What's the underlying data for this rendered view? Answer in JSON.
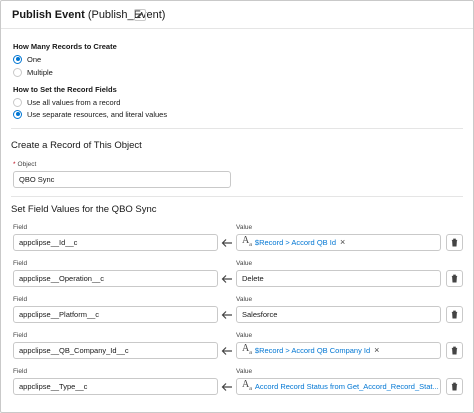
{
  "header": {
    "label": "Publish Event",
    "api_name": "(Publish_Event)"
  },
  "records_to_create": {
    "label": "How Many Records to Create",
    "options": [
      {
        "label": "One",
        "selected": true
      },
      {
        "label": "Multiple",
        "selected": false
      }
    ]
  },
  "set_fields": {
    "label": "How to Set the Record Fields",
    "options": [
      {
        "label": "Use all values from a record",
        "selected": false
      },
      {
        "label": "Use separate resources, and literal values",
        "selected": true
      }
    ]
  },
  "create_record": {
    "title": "Create a Record of This Object",
    "object_label": "Object",
    "object_value": "QBO Sync"
  },
  "field_values": {
    "title": "Set Field Values for the QBO Sync",
    "field_label": "Field",
    "value_label": "Value",
    "rows": [
      {
        "field": "appclipse__Id__c",
        "value": "$Record > Accord QB Id",
        "is_resource": true
      },
      {
        "field": "appclipse__Operation__c",
        "value": "Delete",
        "is_resource": false
      },
      {
        "field": "appclipse__Platform__c",
        "value": "Salesforce",
        "is_resource": false
      },
      {
        "field": "appclipse__QB_Company_Id__c",
        "value": "$Record > Accord QB Company Id",
        "is_resource": true
      },
      {
        "field": "appclipse__Type__c",
        "value": "Accord Record Status from Get_Accord_Record_Stat...",
        "is_resource": true
      }
    ]
  },
  "colors": {
    "accent": "#0176d3",
    "border": "#c9c9c9",
    "divider": "#e5e5e5",
    "required": "#ba0517"
  },
  "icons": [
    "pencil-icon",
    "arrow-left-icon",
    "text-resource-icon",
    "close-icon",
    "trash-icon"
  ]
}
